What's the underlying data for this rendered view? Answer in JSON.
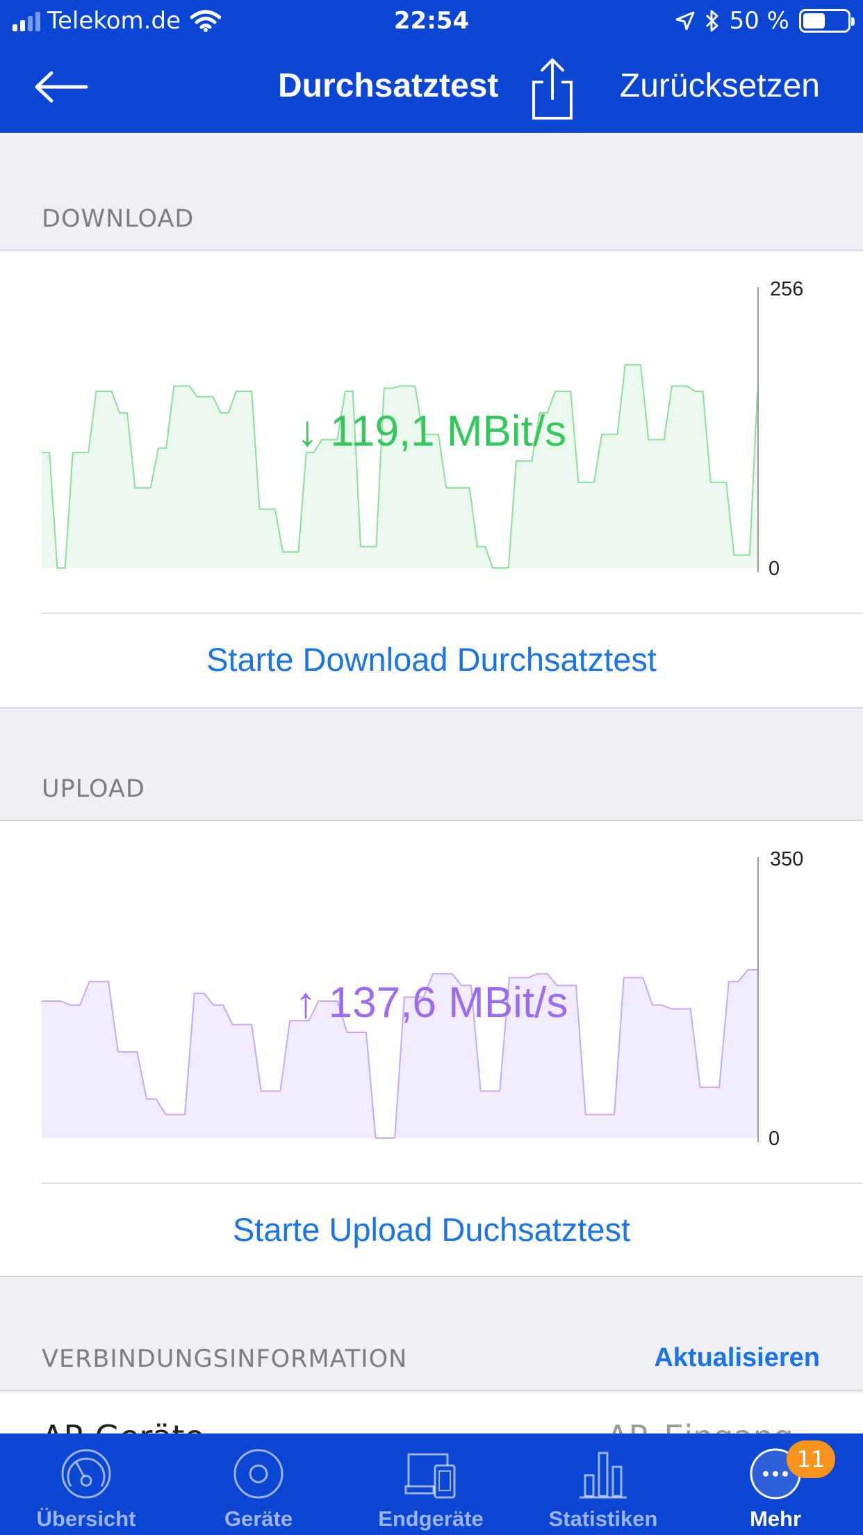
{
  "status_bar": {
    "carrier": "Telekom.de",
    "time": "22:54",
    "battery_text": "50 %",
    "battery_level": 0.5
  },
  "nav": {
    "title": "Durchsatztest",
    "reset_label": "Zurücksetzen"
  },
  "download": {
    "section_label": "DOWNLOAD",
    "speed_text": "↓ 119,1 MBit/s",
    "axis_max_label": "256",
    "axis_min_label": "0",
    "button_label": "Starte Download Durchsatztest",
    "color": "#34c759"
  },
  "upload": {
    "section_label": "UPLOAD",
    "speed_text": "↑ 137,6 MBit/s",
    "axis_max_label": "350",
    "axis_min_label": "0",
    "button_label": "Starte Upload Duchsatztest",
    "color": "#9b6cf2"
  },
  "connection": {
    "section_label": "VERBINDUNGSINFORMATION",
    "action_label": "Aktualisieren"
  },
  "list_row": {
    "left": "AP-Geräte",
    "right": "AP_Eingang"
  },
  "tabs": [
    {
      "label": "Übersicht",
      "icon": "gauge-icon"
    },
    {
      "label": "Geräte",
      "icon": "device-icon"
    },
    {
      "label": "Endgeräte",
      "icon": "clients-icon"
    },
    {
      "label": "Statistiken",
      "icon": "bar-chart-icon"
    },
    {
      "label": "Mehr",
      "icon": "more-icon",
      "badge": "11"
    }
  ],
  "chart_data": [
    {
      "type": "area",
      "title": "↓ 119,1 MBit/s",
      "ylim": [
        0,
        256
      ],
      "series": [
        {
          "values": [
            108,
            108,
            0,
            0,
            108,
            108,
            108,
            165,
            165,
            165,
            145,
            145,
            75,
            75,
            75,
            112,
            112,
            170,
            170,
            170,
            160,
            160,
            160,
            145,
            145,
            165,
            165,
            165,
            55,
            55,
            55,
            15,
            15,
            15,
            108,
            108,
            120,
            120,
            120,
            165,
            165,
            20,
            20,
            20,
            168,
            168,
            170,
            170,
            170,
            125,
            125,
            125,
            75,
            75,
            75,
            75,
            20,
            20,
            0,
            0,
            0,
            100,
            100,
            100,
            145,
            145,
            165,
            165,
            165,
            80,
            80,
            80,
            125,
            125,
            125,
            190,
            190,
            190,
            120,
            120,
            120,
            170,
            170,
            170,
            165,
            165,
            80,
            80,
            80,
            12,
            12,
            12,
            165
          ]
        }
      ]
    },
    {
      "type": "area",
      "title": "↑ 137,6 MBit/s",
      "ylim": [
        0,
        350
      ],
      "series": [
        {
          "values": [
            175,
            175,
            175,
            170,
            170,
            200,
            200,
            200,
            110,
            110,
            110,
            50,
            50,
            30,
            30,
            30,
            185,
            185,
            170,
            170,
            145,
            145,
            145,
            60,
            60,
            60,
            150,
            150,
            150,
            175,
            175,
            175,
            135,
            135,
            135,
            0,
            0,
            0,
            180,
            180,
            180,
            210,
            210,
            210,
            195,
            195,
            60,
            60,
            60,
            205,
            205,
            205,
            210,
            210,
            195,
            195,
            195,
            30,
            30,
            30,
            30,
            205,
            205,
            205,
            170,
            170,
            165,
            165,
            165,
            65,
            65,
            65,
            200,
            200,
            215,
            215
          ]
        }
      ]
    }
  ]
}
